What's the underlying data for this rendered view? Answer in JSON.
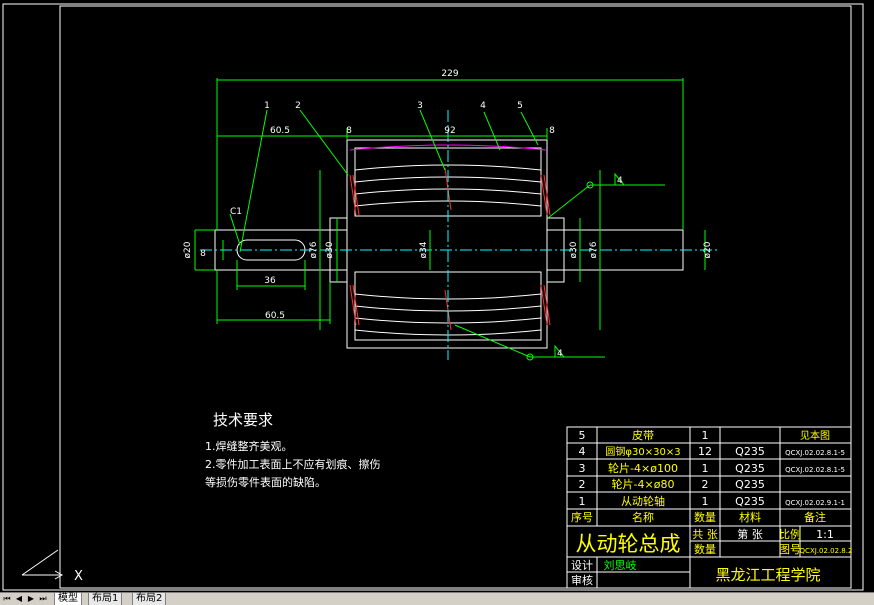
{
  "colors": {
    "background": "#000000",
    "green": "#00ff00",
    "white": "#ffffff",
    "cyan": "#00ffff",
    "yellow": "#ffff00",
    "red": "#ff3030",
    "magenta": "#ff00ff",
    "tab_bg": "#d4d0c8"
  },
  "dims": {
    "overall": "229",
    "left_seg": "60.5",
    "left_seg_bottom": "60.5",
    "key_len": "36",
    "center": "92",
    "hub_left": "8",
    "hub_right": "8",
    "d20_left": "ø20",
    "d20_right": "ø20",
    "d76_left": "ø76",
    "d30_left": "ø30",
    "d34": "ø34",
    "d30_right": "ø30",
    "d76_right": "ø76",
    "key_w": "8",
    "chamfer": "C1"
  },
  "balloons": {
    "b1": "1",
    "b2": "2",
    "b3": "3",
    "b4": "4",
    "b5": "5",
    "weld_top": "4",
    "weld_bottom": "4"
  },
  "tech": {
    "title": "技术要求",
    "line1": "1.焊缝整齐美观。",
    "line2": "2.零件加工表面上不应有划痕、擦伤",
    "line3": "等损伤零件表面的缺陷。"
  },
  "bom": [
    {
      "no": "5",
      "name": "皮带",
      "qty": "1",
      "mat": "",
      "ref": "见本图"
    },
    {
      "no": "4",
      "name": "圆钢φ30×30×3",
      "qty": "12",
      "mat": "Q235",
      "ref": "QCXJ.02.02.8.1-5"
    },
    {
      "no": "3",
      "name": "轮片-4×ø100",
      "qty": "1",
      "mat": "Q235",
      "ref": "QCXJ.02.02.8.1-5"
    },
    {
      "no": "2",
      "name": "轮片-4×ø80",
      "qty": "2",
      "mat": "Q235",
      "ref": ""
    },
    {
      "no": "1",
      "name": "从动轮轴",
      "qty": "1",
      "mat": "Q235",
      "ref": "QCXJ.02.02.9.1-1"
    }
  ],
  "title_block": {
    "h_no": "序号",
    "h_name": "名称",
    "h_qty": "数量",
    "h_mat": "材料",
    "h_note": "备注",
    "drawing_title": "从动轮总成",
    "gong": "共 张",
    "di": "第 张",
    "bili": "比例",
    "scale": "1:1",
    "shuliang": "数量",
    "tuhao": "图号",
    "drawing_no": "QCXJ.02.02.8.2",
    "sheji": "设计",
    "designer": "刘思岐",
    "shenhe": "审核",
    "school": "黑龙江工程学院"
  },
  "tabs": {
    "model": "模型",
    "layout1": "布局1",
    "layout2": "布局2"
  },
  "ucs": {
    "x": "X"
  }
}
